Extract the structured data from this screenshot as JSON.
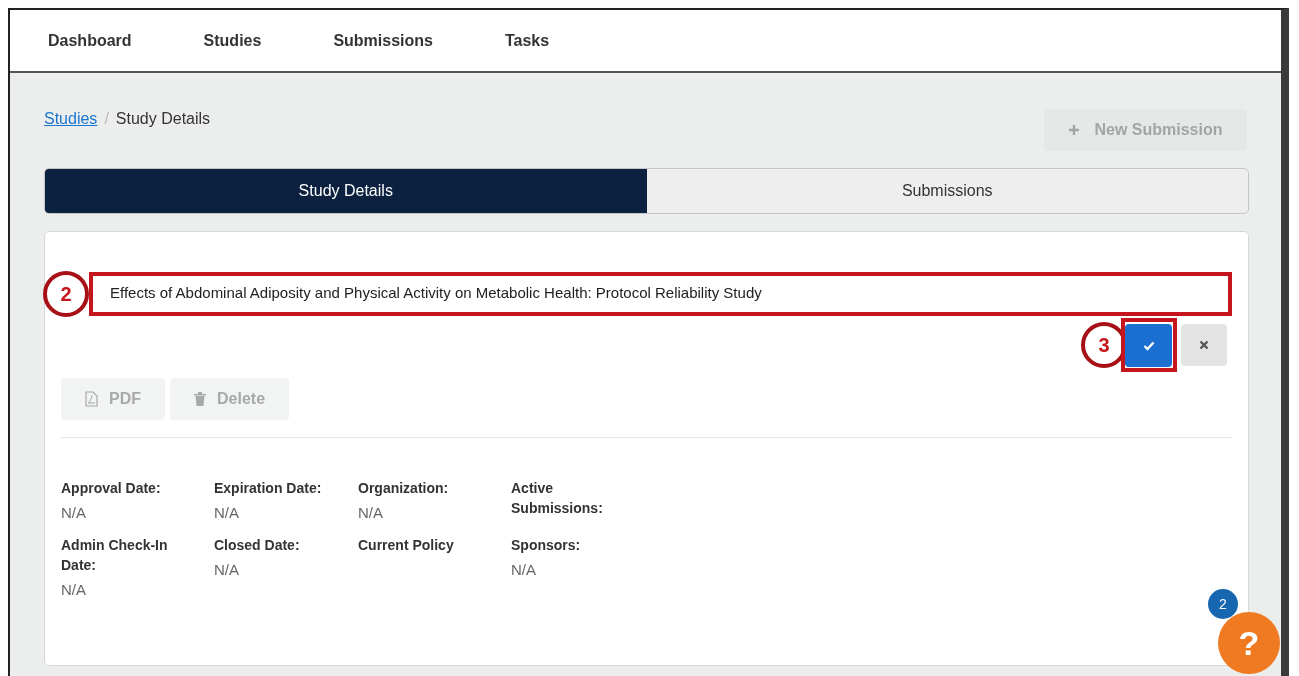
{
  "nav": [
    {
      "label": "Dashboard"
    },
    {
      "label": "Studies"
    },
    {
      "label": "Submissions"
    },
    {
      "label": "Tasks"
    }
  ],
  "breadcrumb": {
    "link": "Studies",
    "separator": "/",
    "current": "Study Details"
  },
  "new_submission": {
    "label": "New Submission",
    "disabled": true
  },
  "tabs": [
    {
      "label": "Study Details",
      "selected": true
    },
    {
      "label": "Submissions",
      "selected": false
    }
  ],
  "title_field": {
    "value": "Effects of Abdominal Adiposity and Physical Activity on Metabolic Health: Protocol Reliability Study",
    "callout": "2"
  },
  "confirm": {
    "callout": "3"
  },
  "actions": [
    {
      "kind": "pdf",
      "label": "PDF",
      "disabled": true
    },
    {
      "kind": "delete",
      "label": "Delete",
      "disabled": true
    }
  ],
  "fields": [
    {
      "label": "Approval Date:",
      "value": "N/A"
    },
    {
      "label": "Expiration Date:",
      "value": "N/A"
    },
    {
      "label": "Organization:",
      "value": "N/A"
    },
    {
      "label": "Active Submissions:"
    },
    {
      "label": "Admin Check-In Date:",
      "value": "N/A"
    },
    {
      "label": "Closed Date:",
      "value": "N/A"
    },
    {
      "label": "Current Policy"
    },
    {
      "label": "Sponsors:",
      "value": "N/A"
    }
  ],
  "help": {
    "badge": "2",
    "label": "?"
  }
}
